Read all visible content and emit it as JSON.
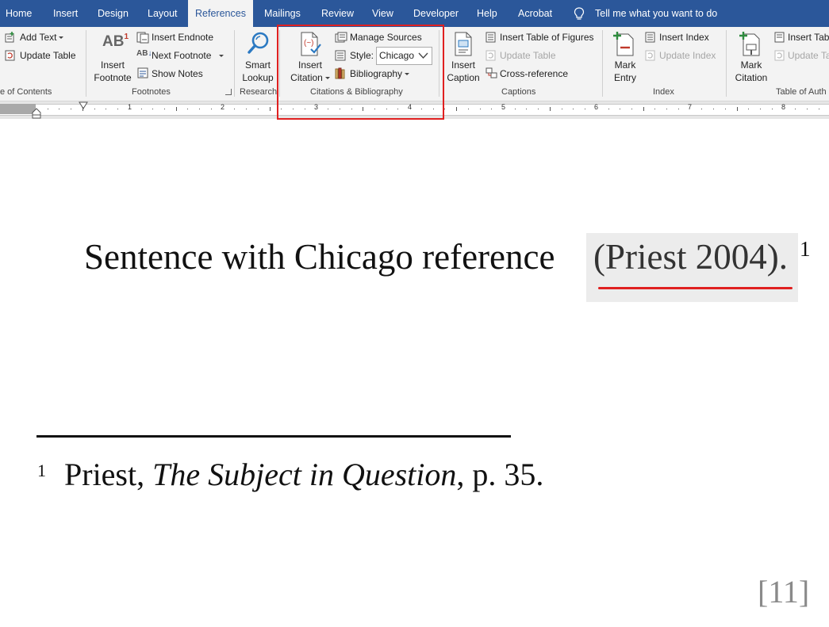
{
  "tabs": [
    "Home",
    "Insert",
    "Design",
    "Layout",
    "References",
    "Mailings",
    "Review",
    "View",
    "Developer",
    "Help",
    "Acrobat"
  ],
  "tell_me": "Tell me what you want to do",
  "toc": {
    "add_text": "Add Text",
    "update_table": "Update Table",
    "group_label": "e of Contents"
  },
  "footnotes": {
    "insert_footnote_l1": "Insert",
    "insert_footnote_l2": "Footnote",
    "insert_endnote": "Insert Endnote",
    "next_footnote": "Next Footnote",
    "show_notes": "Show Notes",
    "group_label": "Footnotes"
  },
  "research": {
    "smart_lookup_l1": "Smart",
    "smart_lookup_l2": "Lookup",
    "group_label": "Research"
  },
  "citations": {
    "insert_citation_l1": "Insert",
    "insert_citation_l2": "Citation",
    "manage_sources": "Manage Sources",
    "style_label": "Style:",
    "style_value": "Chicago",
    "bibliography": "Bibliography",
    "group_label": "Citations & Bibliography"
  },
  "captions": {
    "insert_caption_l1": "Insert",
    "insert_caption_l2": "Caption",
    "insert_table_of_figures": "Insert Table of Figures",
    "update_table": "Update Table",
    "cross_reference": "Cross-reference",
    "group_label": "Captions"
  },
  "index": {
    "mark_entry_l1": "Mark",
    "mark_entry_l2": "Entry",
    "insert_index": "Insert Index",
    "update_index": "Update Index",
    "group_label": "Index"
  },
  "authorities": {
    "mark_citation_l1": "Mark",
    "mark_citation_l2": "Citation",
    "insert_table": "Insert Tabl",
    "update_table": "Update Ta",
    "group_label": "Table of Auth"
  },
  "ruler_numbers": [
    "1",
    "2",
    "3",
    "4",
    "5",
    "6",
    "7",
    "8"
  ],
  "document": {
    "sentence": "Sentence with Chicago reference",
    "citation": "(Priest 2004).",
    "footnote_ref": "1",
    "footnote_number": "1",
    "footnote_author": "Priest, ",
    "footnote_title": "The Subject in Question",
    "footnote_page": ", p. 35.",
    "page_marker": "[11]"
  },
  "colors": {
    "ribbon_blue": "#2b579a",
    "highlight_red": "#e02020"
  }
}
